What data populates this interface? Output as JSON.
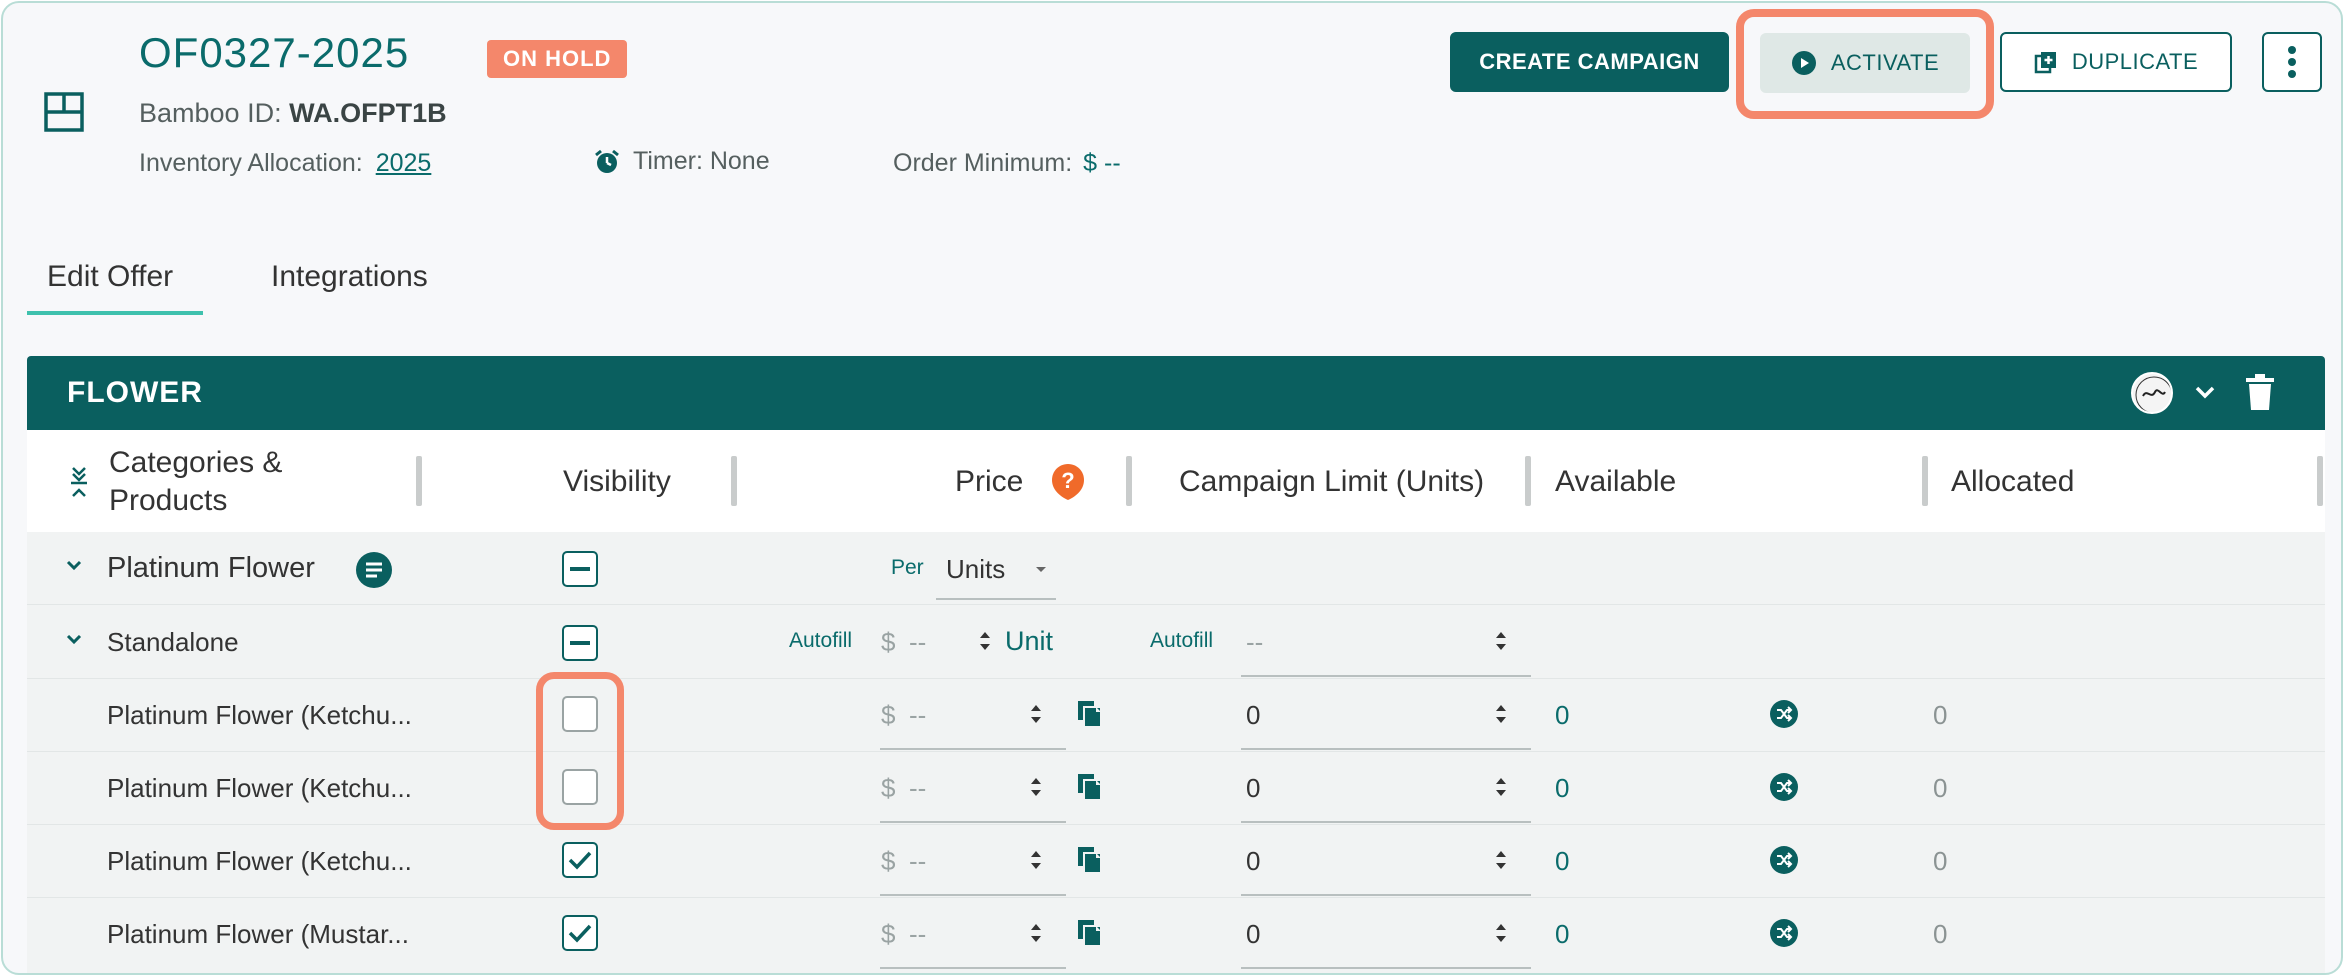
{
  "offer": {
    "id": "OF0327-2025",
    "status": "ON HOLD",
    "bamboo_label": "Bamboo ID:",
    "bamboo_id": "WA.OFPT1B",
    "inventory_label": "Inventory Allocation:",
    "inventory_value": "2025",
    "timer_text": "Timer: None",
    "order_min_label": "Order Minimum:",
    "order_min_value": "$ --"
  },
  "actions": {
    "create_campaign": "CREATE CAMPAIGN",
    "activate": "ACTIVATE",
    "duplicate": "DUPLICATE"
  },
  "tabs": [
    {
      "label": "Edit Offer",
      "active": true
    },
    {
      "label": "Integrations",
      "active": false
    }
  ],
  "section": {
    "title": "FLOWER"
  },
  "columns": {
    "categories": "Categories &",
    "products": "Products",
    "visibility": "Visibility",
    "price": "Price",
    "campaign_limit": "Campaign Limit (Units)",
    "available": "Available",
    "allocated": "Allocated"
  },
  "group": {
    "name": "Platinum Flower",
    "per_label": "Per",
    "per_value": "Units"
  },
  "subgroup": {
    "name": "Standalone",
    "autofill_label": "Autofill",
    "price_currency": "$",
    "price_value": "--",
    "unit_label": "Unit",
    "limit_autofill_label": "Autofill",
    "limit_value": "--"
  },
  "products": [
    {
      "name": "Platinum Flower (Ketchu...",
      "visible": false,
      "currency": "$",
      "price": "--",
      "limit": "0",
      "available": "0",
      "allocated": "0"
    },
    {
      "name": "Platinum Flower (Ketchu...",
      "visible": false,
      "currency": "$",
      "price": "--",
      "limit": "0",
      "available": "0",
      "allocated": "0"
    },
    {
      "name": "Platinum Flower (Ketchu...",
      "visible": true,
      "currency": "$",
      "price": "--",
      "limit": "0",
      "available": "0",
      "allocated": "0"
    },
    {
      "name": "Platinum Flower (Mustar...",
      "visible": true,
      "currency": "$",
      "price": "--",
      "limit": "0",
      "available": "0",
      "allocated": "0"
    }
  ],
  "colors": {
    "primary": "#0a5f5f",
    "accent": "#3ec1ad",
    "status": "#f4876b"
  }
}
